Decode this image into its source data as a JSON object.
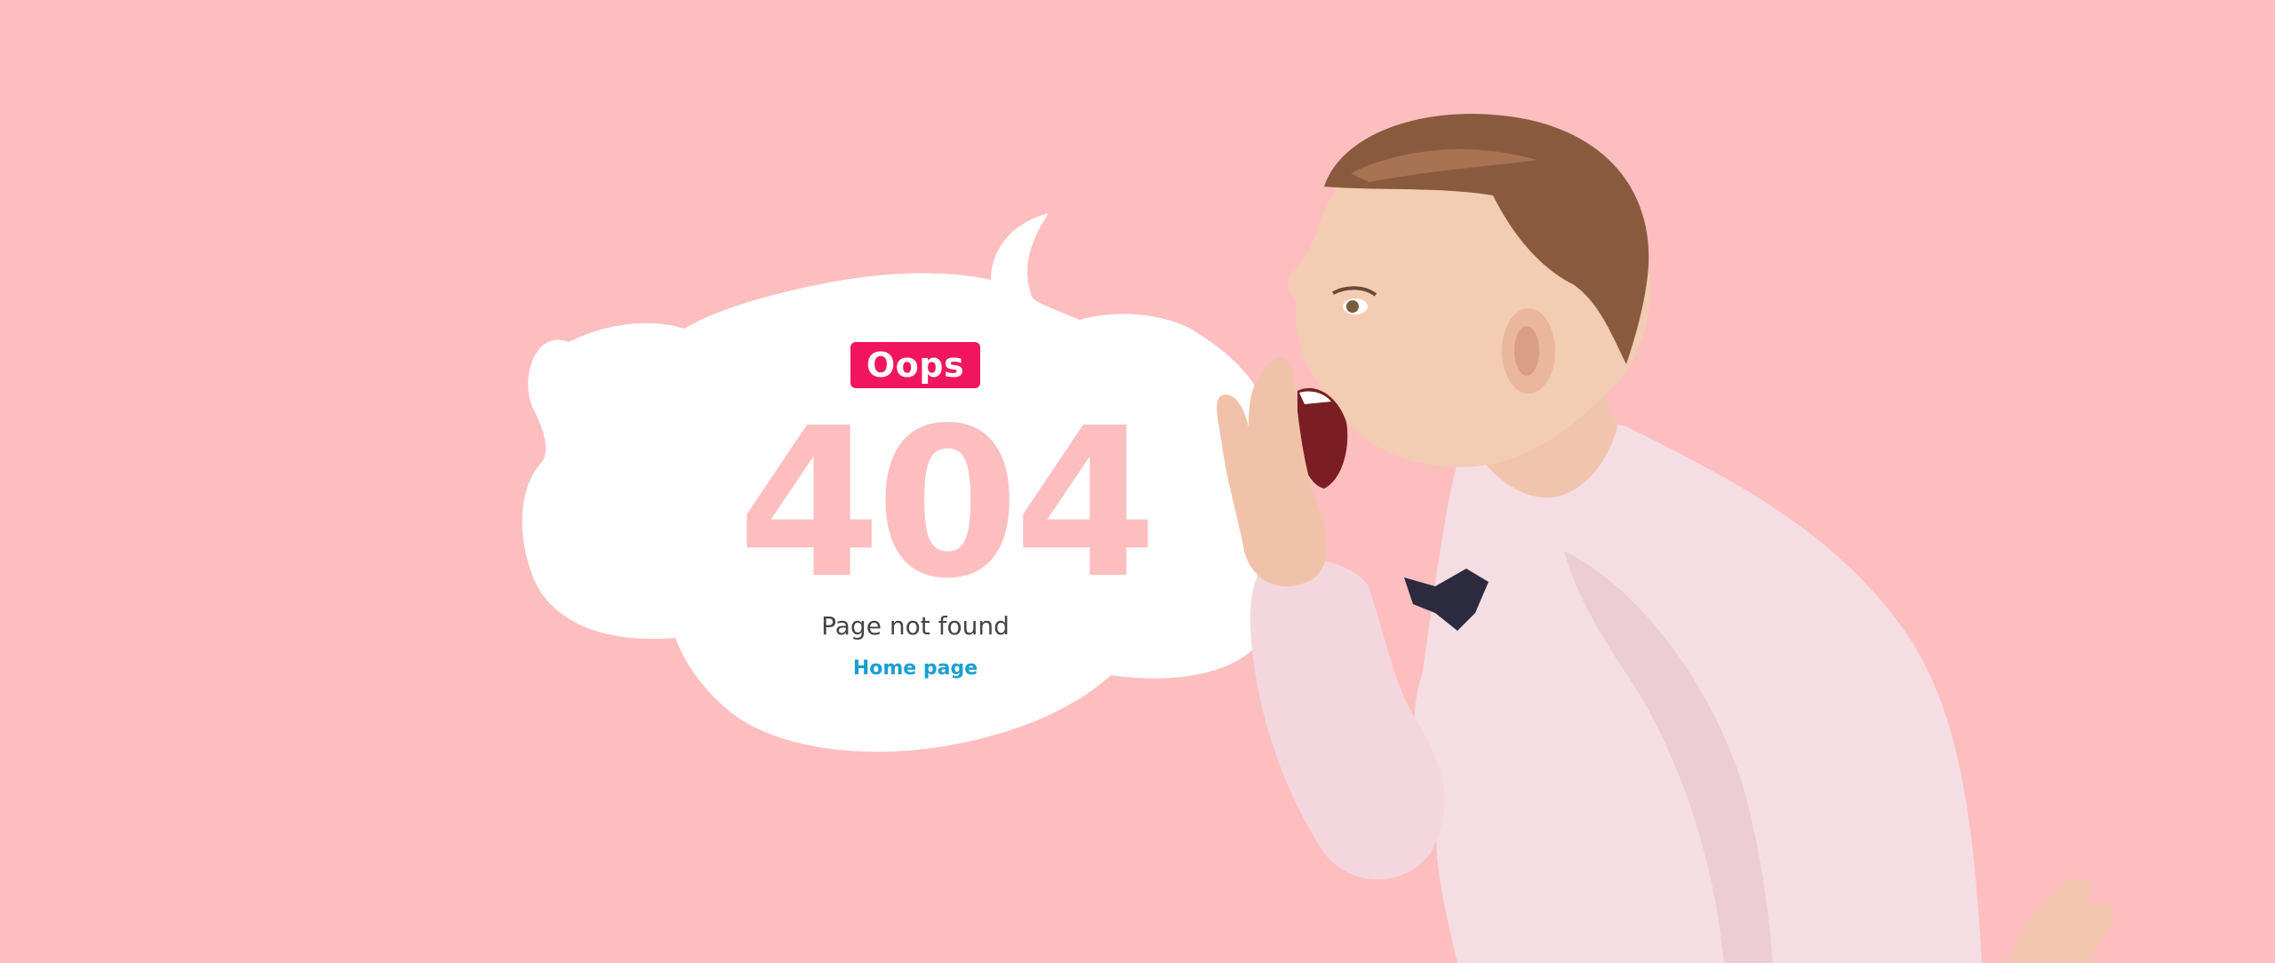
{
  "badge": {
    "label": "Oops"
  },
  "error": {
    "code": "404",
    "message": "Page not found"
  },
  "nav": {
    "home_label": "Home page"
  },
  "colors": {
    "background": "#fdbebf",
    "bubble": "#ffffff",
    "badge_bg": "#f0155f",
    "code_color": "#fdbebf",
    "link_color": "#1a9fd0",
    "message_color": "#444444"
  },
  "illustration": {
    "subject": "shouting-boy-photo"
  }
}
